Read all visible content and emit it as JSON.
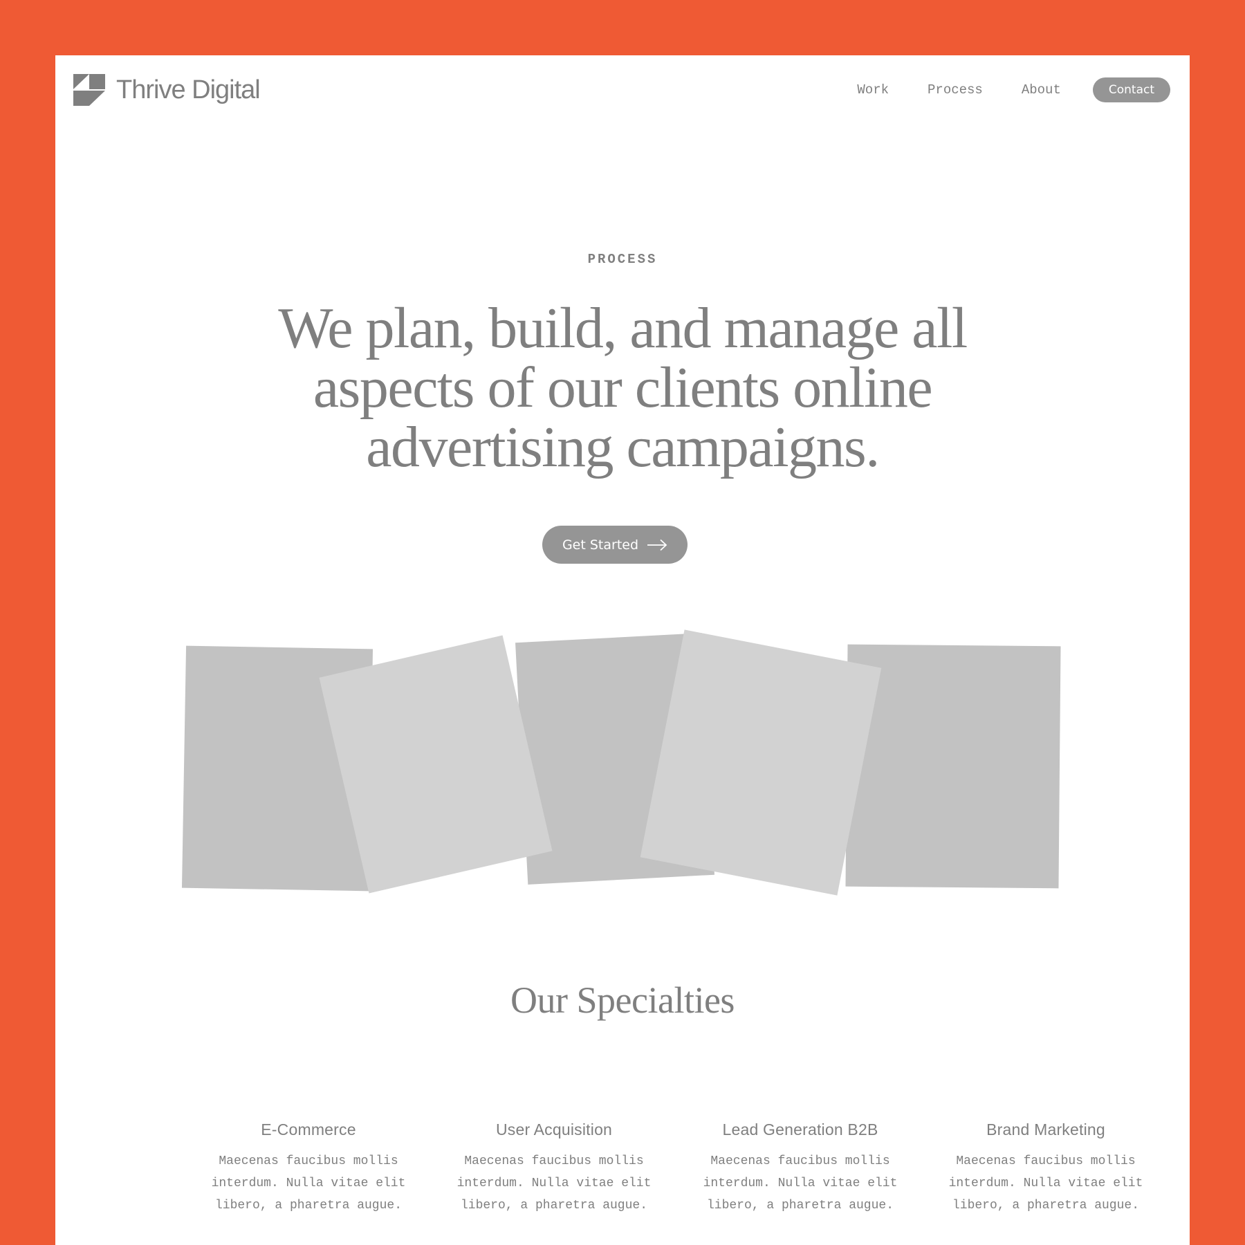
{
  "brand": {
    "name": "Thrive Digital",
    "logo_icon": "thrive-logo-icon"
  },
  "nav": {
    "links": [
      "Work",
      "Process",
      "About"
    ],
    "contact_label": "Contact"
  },
  "hero": {
    "eyebrow": "PROCESS",
    "headline": "We plan, build, and manage all aspects of our clients online advertising campaigns.",
    "cta_label": "Get Started",
    "cta_icon": "arrow-right-icon"
  },
  "gallery": {
    "tiles": [
      {
        "name": "gallery-image-1",
        "tone": "dark"
      },
      {
        "name": "gallery-image-2",
        "tone": "light"
      },
      {
        "name": "gallery-image-3",
        "tone": "dark"
      },
      {
        "name": "gallery-image-4",
        "tone": "light"
      },
      {
        "name": "gallery-image-5",
        "tone": "dark"
      }
    ]
  },
  "specialties": {
    "title": "Our Specialties",
    "items": [
      {
        "title": "E-Commerce",
        "desc": "Maecenas faucibus mollis interdum. Nulla vitae elit libero, a pharetra augue."
      },
      {
        "title": "User Acquisition",
        "desc": "Maecenas faucibus mollis interdum. Nulla vitae elit libero, a pharetra augue."
      },
      {
        "title": "Lead Generation B2B",
        "desc": "Maecenas faucibus mollis interdum. Nulla vitae elit libero, a pharetra augue."
      },
      {
        "title": "Brand Marketing",
        "desc": "Maecenas faucibus mollis interdum. Nulla vitae elit libero, a pharetra augue."
      }
    ]
  },
  "colors": {
    "frame": "#EF5A34",
    "page": "#FFFFFF",
    "text": "#7F7F7F",
    "button": "#959595",
    "tile_dark": "#C2C2C2",
    "tile_light": "#D2D2D2"
  }
}
